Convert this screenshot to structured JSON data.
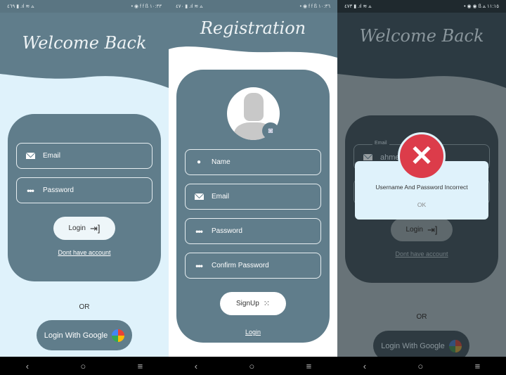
{
  "status_bars": [
    {
      "left": "٤٦٩ ▮ .ıl ≋ ⩟",
      "right": "• ◉ f f ß ١٠:٣٣"
    },
    {
      "left": "٤٧٠ ▮ .ıl ≋ ⩟",
      "right": "• ◉ f f ß ١٠:٣٦"
    },
    {
      "left": "٤٧٣ ▮ .ıl ≋ ⩟",
      "right": "• ◉ ◉ ß ⩟ ١١:١٥"
    }
  ],
  "login": {
    "title": "Welcome Back",
    "email_placeholder": "Email",
    "password_placeholder": "Password",
    "login_button": "Login",
    "no_account_link": "Dont have account",
    "or": "OR",
    "google_button": "Login With Google"
  },
  "register": {
    "title": "Registration",
    "name_placeholder": "Name",
    "email_placeholder": "Email",
    "password_placeholder": "Password",
    "confirm_placeholder": "Confirm Password",
    "signup_button": "SignUp",
    "login_link": "Login"
  },
  "error_screen": {
    "title": "Welcome Back",
    "email_label": "Email",
    "email_value": "ahmed",
    "login_button": "Login",
    "no_account_link": "Dont have account",
    "or": "OR",
    "google_button": "Login With Google",
    "dialog": {
      "message": "Username And Password Incorrect",
      "ok_button": "OK"
    }
  },
  "nav": {
    "back": "‹",
    "home": "○",
    "recents": "≡"
  },
  "colors": {
    "primary": "#607d8b",
    "light_bg": "#dff2fb",
    "error": "#dc3c4a"
  }
}
